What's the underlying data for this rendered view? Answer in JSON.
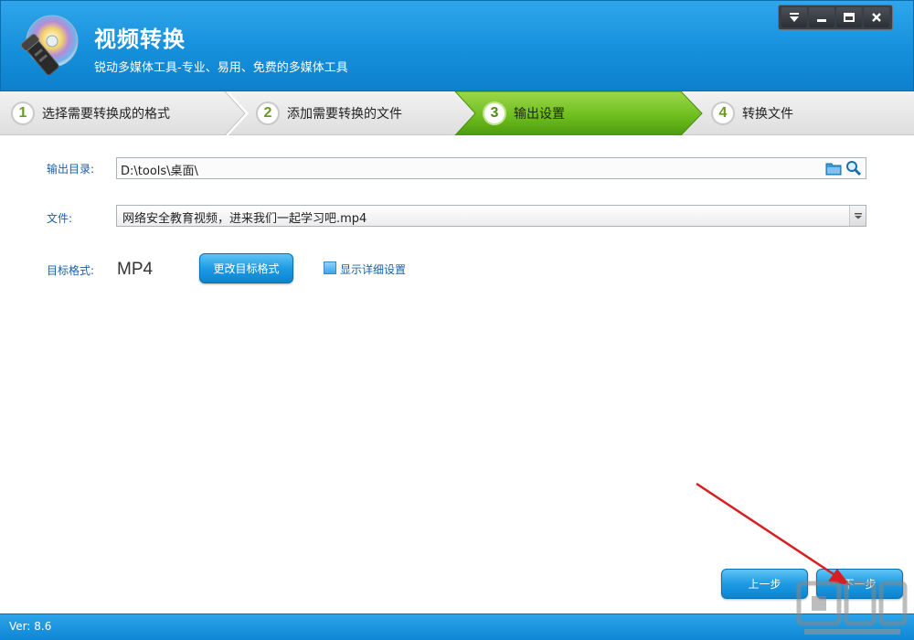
{
  "header": {
    "title": "视频转换",
    "subtitle": "锐动多媒体工具-专业、易用、免费的多媒体工具"
  },
  "window_buttons": [
    "dropdown-icon",
    "minimize-icon",
    "restore-icon",
    "close-icon"
  ],
  "steps": [
    {
      "num": "1",
      "label": "选择需要转换成的格式",
      "active": false
    },
    {
      "num": "2",
      "label": "添加需要转换的文件",
      "active": false
    },
    {
      "num": "3",
      "label": "输出设置",
      "active": true
    },
    {
      "num": "4",
      "label": "转换文件",
      "active": false
    }
  ],
  "form": {
    "output_dir_label": "输出目录:",
    "output_dir_value": "D:\\tools\\桌面\\",
    "file_label": "文件:",
    "file_value": "网络安全教育视频，进来我们一起学习吧.mp4",
    "target_format_label": "目标格式:",
    "target_format_value": "MP4",
    "change_format_button": "更改目标格式",
    "show_details_label": "显示详细设置",
    "show_details_checked": false
  },
  "nav": {
    "prev_button": "上一步",
    "next_button": "下一步"
  },
  "footer": {
    "version": "Ver: 8.6"
  },
  "colors": {
    "header_blue": "#1690db",
    "active_step_green": "#6fbf1f",
    "label_blue": "#1a5fa8",
    "annotation_arrow": "#d81e1e"
  }
}
